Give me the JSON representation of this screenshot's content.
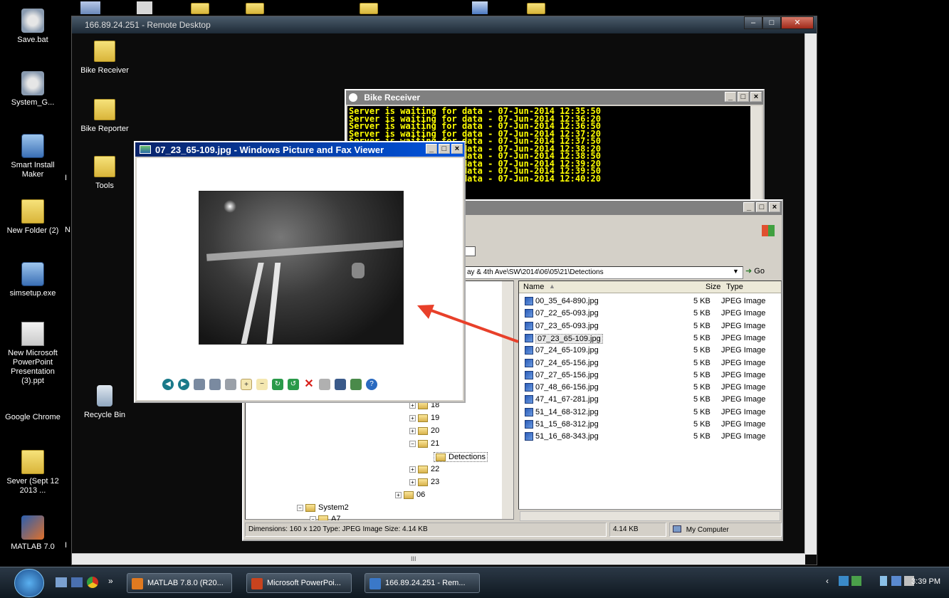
{
  "outer_desktop": {
    "icons": [
      {
        "label": "Save.bat",
        "icon": "gear-icon"
      },
      {
        "label": "System_G...",
        "icon": "gear-icon"
      },
      {
        "label": "Smart Install Maker",
        "icon": "install-icon"
      },
      {
        "label": "New Folder (2)",
        "icon": "folder-icon"
      },
      {
        "label": "simsetup.exe",
        "icon": "setup-icon"
      },
      {
        "label": "New Microsoft PowerPoint Presentation (3).ppt",
        "icon": "powerpoint-icon"
      },
      {
        "label": "Google Chrome",
        "icon": "chrome-icon"
      },
      {
        "label": "Sever (Sept 12 2013 ...",
        "icon": "folder-icon"
      },
      {
        "label": "MATLAB 7.0",
        "icon": "matlab-icon"
      }
    ],
    "partial_labels": [
      "I",
      "N",
      "I"
    ]
  },
  "rdp": {
    "title": "166.89.24.251 - Remote Desktop",
    "hscroll_label": "III"
  },
  "inner_desktop": {
    "icons": [
      {
        "label": "Bike Receiver"
      },
      {
        "label": "Bike Reporter"
      },
      {
        "label": "Tools"
      },
      {
        "label": "Recycle Bin"
      }
    ]
  },
  "console": {
    "title": "Bike Receiver",
    "lines": [
      "Server is waiting for data - 07-Jun-2014 12:35:50",
      "Server is waiting for data - 07-Jun-2014 12:36:20",
      "Server is waiting for data - 07-Jun-2014 12:36:50",
      "Server is waiting for data - 07-Jun-2014 12:37:20",
      "Server is waiting for data - 07-Jun-2014 12:37:50",
      "Server is waiting for data - 07-Jun-2014 12:38:20",
      "Server is waiting for data - 07-Jun-2014 12:38:50",
      "Server is waiting for data - 07-Jun-2014 12:39:20",
      "Server is waiting for data - 07-Jun-2014 12:39:50",
      "Server is waiting for data - 07-Jun-2014 12:40:20"
    ]
  },
  "explorer": {
    "address": "ay & 4th Ave\\SW\\2014\\06\\05\\21\\Detections",
    "go_label": "Go",
    "columns": {
      "name": "Name",
      "size": "Size",
      "type": "Type"
    },
    "files": [
      {
        "name": "00_35_64-890.jpg",
        "size": "5 KB",
        "type": "JPEG Image"
      },
      {
        "name": "07_22_65-093.jpg",
        "size": "5 KB",
        "type": "JPEG Image"
      },
      {
        "name": "07_23_65-093.jpg",
        "size": "5 KB",
        "type": "JPEG Image"
      },
      {
        "name": "07_23_65-109.jpg",
        "size": "5 KB",
        "type": "JPEG Image"
      },
      {
        "name": "07_24_65-109.jpg",
        "size": "5 KB",
        "type": "JPEG Image"
      },
      {
        "name": "07_24_65-156.jpg",
        "size": "5 KB",
        "type": "JPEG Image"
      },
      {
        "name": "07_27_65-156.jpg",
        "size": "5 KB",
        "type": "JPEG Image"
      },
      {
        "name": "07_48_66-156.jpg",
        "size": "5 KB",
        "type": "JPEG Image"
      },
      {
        "name": "47_41_67-281.jpg",
        "size": "5 KB",
        "type": "JPEG Image"
      },
      {
        "name": "51_14_68-312.jpg",
        "size": "5 KB",
        "type": "JPEG Image"
      },
      {
        "name": "51_15_68-312.jpg",
        "size": "5 KB",
        "type": "JPEG Image"
      },
      {
        "name": "51_16_68-343.jpg",
        "size": "5 KB",
        "type": "JPEG Image"
      }
    ],
    "selected_index": 3,
    "tree": [
      {
        "label": "18",
        "pm": "+"
      },
      {
        "label": "19",
        "pm": "+"
      },
      {
        "label": "20",
        "pm": "+"
      },
      {
        "label": "21",
        "pm": "−"
      },
      {
        "label": "Detections",
        "pm": ""
      },
      {
        "label": "22",
        "pm": "+"
      },
      {
        "label": "23",
        "pm": "+"
      },
      {
        "label": "06",
        "pm": "+"
      },
      {
        "label": "System2",
        "pm": "−"
      },
      {
        "label": "A7",
        "pm": "−"
      }
    ],
    "close_x": "×",
    "status": {
      "info": "Dimensions: 160 x 120 Type: JPEG Image Size: 4.14 KB",
      "size": "4.14 KB",
      "zone": "My Computer"
    }
  },
  "viewer": {
    "title": "07_23_65-109.jpg - Windows Picture and Fax Viewer"
  },
  "taskbar": {
    "overflow": "»",
    "tasks": [
      {
        "label": "MATLAB 7.8.0 (R20...",
        "color": "#e07a20"
      },
      {
        "label": "Microsoft PowerPoi...",
        "color": "#c8431e"
      },
      {
        "label": "166.89.24.251 - Rem...",
        "color": "#3a78c8"
      }
    ],
    "clock": "3:39 PM"
  },
  "colors": {
    "arrow": "#e8402a",
    "console_text": "#ffff00",
    "viewer_title": "#0a246a"
  }
}
